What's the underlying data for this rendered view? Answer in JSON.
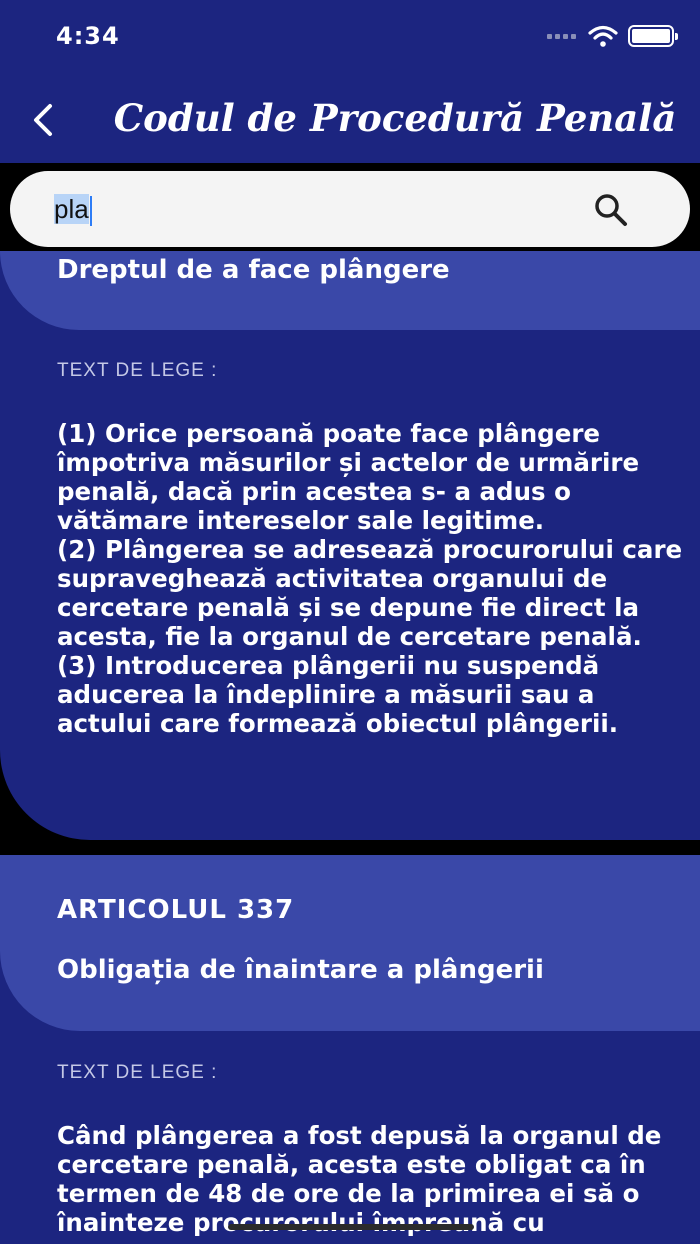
{
  "status_bar": {
    "time": "4:34"
  },
  "header": {
    "title": "Codul de Procedură Penală"
  },
  "search": {
    "selected_text": "pla"
  },
  "articles": [
    {
      "title": "Dreptul de a face plângere",
      "section_label": "TEXT DE LEGE :",
      "text": "(1) Orice persoană poate face plângere împotriva măsurilor și actelor de urmărire penală, dacă prin acestea s- a adus o vătămare intereselor sale legitime.\n(2) Plângerea se adresează procurorului care supraveghează activitatea organului de cercetare penală și se depune fie direct la acesta, fie la organul de cercetare penală.\n(3) Introducerea plângerii nu suspendă aducerea la îndeplinire a măsurii sau a actului care formează obiectul plângerii."
    },
    {
      "number": "ARTICOLUL  337",
      "title": "Obligația de înaintare a plângerii",
      "section_label": "TEXT DE LEGE :",
      "text": "Când plângerea a fost depusă la organul de cercetare penală, acesta este obligat ca în termen de 48 de ore de la primirea ei să o înainteze procurorului împreună cu"
    }
  ],
  "colors": {
    "primary": "#1c2580",
    "header_band": "#3a48a8",
    "background": "#000000",
    "search_bg": "#f4f4f4"
  }
}
